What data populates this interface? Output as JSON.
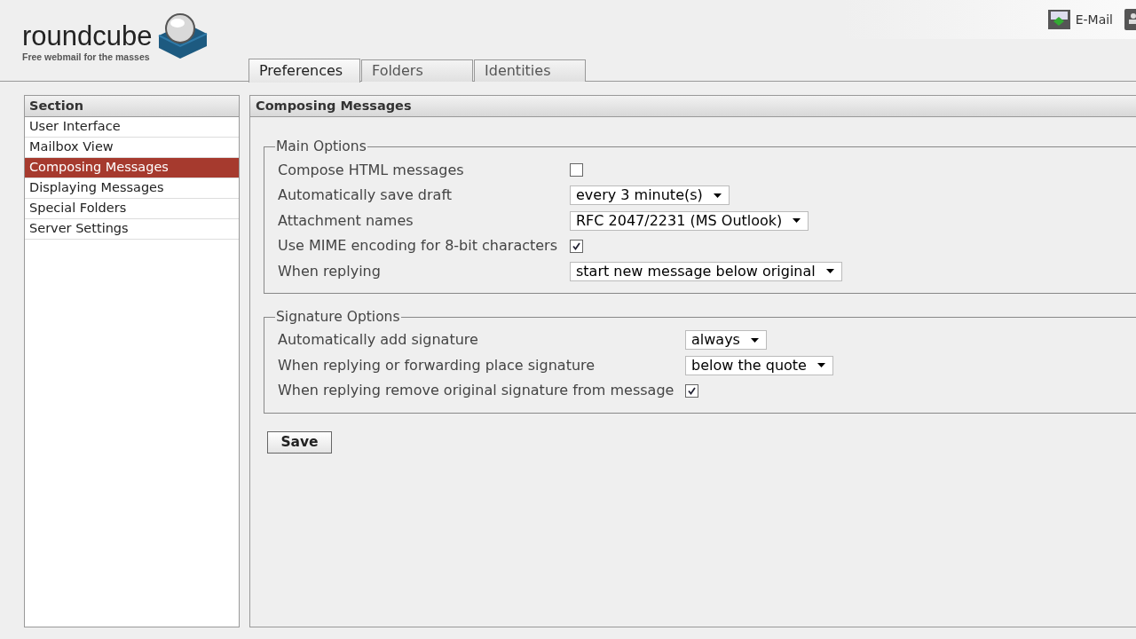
{
  "logo": {
    "name": "roundcube",
    "tagline": "Free webmail for the masses"
  },
  "toolbar": [
    {
      "kind": "email",
      "label": "E-Mail"
    },
    {
      "kind": "addressbook"
    }
  ],
  "tabs": [
    {
      "label": "Preferences",
      "selected": true
    },
    {
      "label": "Folders",
      "selected": false
    },
    {
      "label": "Identities",
      "selected": false
    }
  ],
  "sidebar": {
    "title": "Section",
    "items": [
      {
        "label": "User Interface",
        "selected": false
      },
      {
        "label": "Mailbox View",
        "selected": false
      },
      {
        "label": "Composing Messages",
        "selected": true
      },
      {
        "label": "Displaying Messages",
        "selected": false
      },
      {
        "label": "Special Folders",
        "selected": false
      },
      {
        "label": "Server Settings",
        "selected": false
      }
    ]
  },
  "panel": {
    "title": "Composing Messages",
    "fieldsets": [
      {
        "legend": "Main Options",
        "rows": [
          {
            "kind": "checkbox",
            "label": "Compose HTML messages",
            "checked": false
          },
          {
            "kind": "select",
            "label": "Automatically save draft",
            "value": "every 3 minute(s)"
          },
          {
            "kind": "select",
            "label": "Attachment names",
            "value": "RFC 2047/2231 (MS Outlook)"
          },
          {
            "kind": "checkbox",
            "label": "Use MIME encoding for 8-bit characters",
            "checked": true
          },
          {
            "kind": "select",
            "label": "When replying",
            "value": "start new message below original"
          }
        ]
      },
      {
        "legend": "Signature Options",
        "rows": [
          {
            "kind": "select",
            "label": "Automatically add signature",
            "value": "always"
          },
          {
            "kind": "select",
            "label": "When replying or forwarding place signature",
            "value": "below the quote"
          },
          {
            "kind": "checkbox",
            "label": "When replying remove original signature from message",
            "checked": true
          }
        ]
      }
    ],
    "save": "Save"
  }
}
